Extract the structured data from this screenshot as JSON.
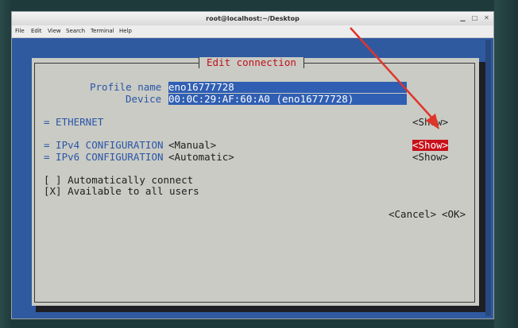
{
  "window": {
    "title": "root@localhost:~/Desktop",
    "controls": [
      "minimize-icon",
      "maximize-icon",
      "close-icon"
    ]
  },
  "menu": {
    "file": "File",
    "edit": "Edit",
    "view": "View",
    "search": "Search",
    "terminal": "Terminal",
    "help": "Help"
  },
  "dialog": {
    "title": "Edit connection",
    "profile_label": "Profile name",
    "profile_value": "eno16777728",
    "device_label": "Device",
    "device_value": "00:0C:29:AF:60:A0 (eno16777728)",
    "ethernet": {
      "label": "= ETHERNET",
      "button": "<Show>"
    },
    "ipv4": {
      "label": "= IPv4 CONFIGURATION",
      "mode": "<Manual>",
      "button": "<Show>"
    },
    "ipv6": {
      "label": "= IPv6 CONFIGURATION",
      "mode": "<Automatic>",
      "button": "<Show>"
    },
    "auto_connect": "[ ] Automatically connect",
    "all_users": "[X] Available to all users",
    "cancel": "<Cancel>",
    "ok": "<OK>"
  },
  "colors": {
    "terminal_bg": "#2f5aa0",
    "dialog_bg": "#c9cbc4",
    "highlight": "#c8101a",
    "label_blue": "#2b55a8",
    "annotation_arrow": "#e0342b"
  }
}
